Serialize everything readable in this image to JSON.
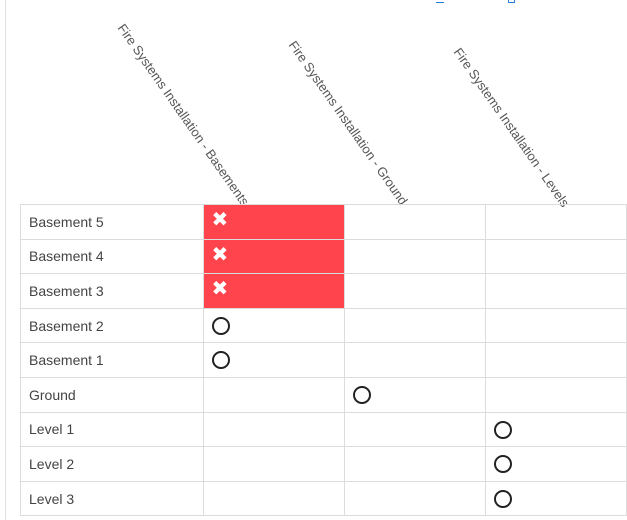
{
  "columns": [
    "Fire Systems Installation - Basements",
    "Fire Systems Installation - Ground",
    "Fire Systems Installation - Levels"
  ],
  "rows": [
    {
      "label": "Basement 5",
      "cells": [
        "failed",
        "",
        ""
      ]
    },
    {
      "label": "Basement 4",
      "cells": [
        "failed",
        "",
        ""
      ]
    },
    {
      "label": "Basement 3",
      "cells": [
        "failed",
        "",
        ""
      ]
    },
    {
      "label": "Basement 2",
      "cells": [
        "pending",
        "",
        ""
      ]
    },
    {
      "label": "Basement 1",
      "cells": [
        "pending",
        "",
        ""
      ]
    },
    {
      "label": "Ground",
      "cells": [
        "",
        "pending",
        ""
      ]
    },
    {
      "label": "Level 1",
      "cells": [
        "",
        "",
        "pending"
      ]
    },
    {
      "label": "Level 2",
      "cells": [
        "",
        "",
        "pending"
      ]
    },
    {
      "label": "Level 3",
      "cells": [
        "",
        "",
        "pending"
      ]
    }
  ],
  "status_colors": {
    "failed": "#ff444d",
    "pending": "#222222"
  },
  "icons": {
    "failed": "close-icon",
    "pending": "circle-icon"
  },
  "glyphs": {
    "failed": "✖"
  }
}
